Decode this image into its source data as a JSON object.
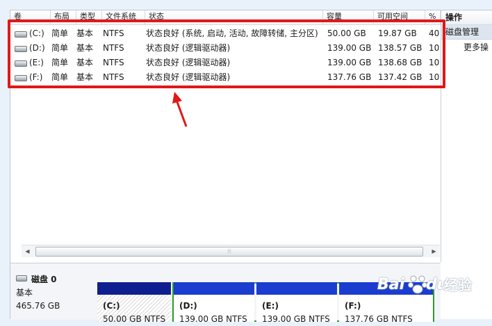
{
  "columns": [
    {
      "key": "vol",
      "label": "卷"
    },
    {
      "key": "layout",
      "label": "布局"
    },
    {
      "key": "type",
      "label": "类型"
    },
    {
      "key": "fs",
      "label": "文件系统"
    },
    {
      "key": "status",
      "label": "状态"
    },
    {
      "key": "capacity",
      "label": "容量"
    },
    {
      "key": "free",
      "label": "可用空间"
    },
    {
      "key": "pct",
      "label": "%"
    }
  ],
  "volumes": [
    {
      "vol": "(C:)",
      "layout": "简单",
      "type": "基本",
      "fs": "NTFS",
      "status": "状态良好 (系统, 启动, 活动, 故障转储, 主分区)",
      "capacity": "50.00 GB",
      "free": "19.87 GB",
      "pct": "40"
    },
    {
      "vol": "(D:)",
      "layout": "简单",
      "type": "基本",
      "fs": "NTFS",
      "status": "状态良好 (逻辑驱动器)",
      "capacity": "139.00 GB",
      "free": "138.57 GB",
      "pct": "10"
    },
    {
      "vol": "(E:)",
      "layout": "简单",
      "type": "基本",
      "fs": "NTFS",
      "status": "状态良好 (逻辑驱动器)",
      "capacity": "139.00 GB",
      "free": "138.68 GB",
      "pct": "10"
    },
    {
      "vol": "(F:)",
      "layout": "简单",
      "type": "基本",
      "fs": "NTFS",
      "status": "状态良好 (逻辑驱动器)",
      "capacity": "137.76 GB",
      "free": "137.42 GB",
      "pct": "10"
    }
  ],
  "actions": {
    "header": "操作",
    "section": "磁盘管理",
    "more": "更多操"
  },
  "scrollbar": {
    "grip": "⦙⦙⦙"
  },
  "disk": {
    "name": "磁盘 0",
    "type": "基本",
    "size": "465.76 GB",
    "partitions": [
      {
        "name": "(C:)",
        "info": "50.00 GB NTFS"
      },
      {
        "name": "(D:)",
        "info": "139.00 GB NTFS"
      },
      {
        "name": "(E:)",
        "info": "139.00 GB NTFS"
      },
      {
        "name": "(F:)",
        "info": "137.76 GB NTFS"
      }
    ]
  },
  "watermark": {
    "brand": "Bai",
    "brand2": "du",
    "suffix": "经验"
  },
  "colors": {
    "highlight": "#e01818",
    "primary_bar": "#0f1f8f",
    "logical_bar": "#1a3ccf",
    "extended_border": "#2e9a2e"
  }
}
